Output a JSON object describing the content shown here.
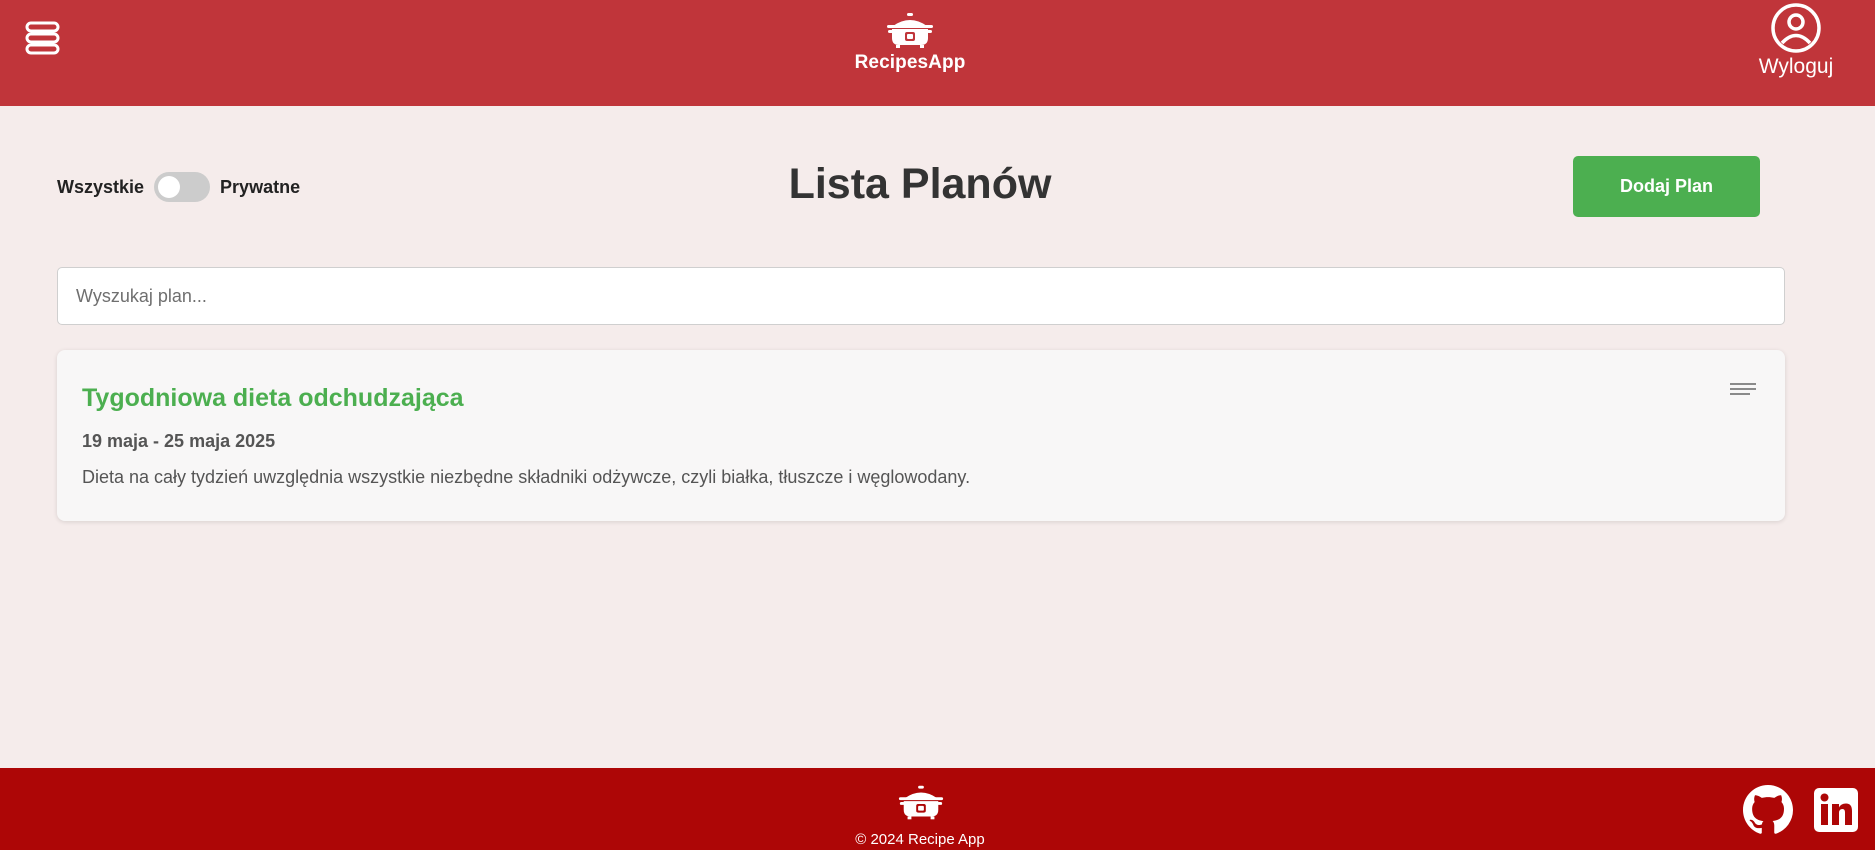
{
  "header": {
    "brand_name": "RecipesApp",
    "logout_label": "Wyloguj"
  },
  "toolbar": {
    "filter_all_label": "Wszystkie",
    "filter_private_label": "Prywatne",
    "private_only": false,
    "page_title": "Lista Planów",
    "add_button_label": "Dodaj Plan"
  },
  "search": {
    "placeholder": "Wyszukaj plan...",
    "value": ""
  },
  "plans": [
    {
      "title": "Tygodniowa dieta odchudzająca",
      "dates": "19 maja - 25 maja 2025",
      "description": "Dieta na cały tydzień uwzględnia wszystkie niezbędne składniki odżywcze, czyli białka, tłuszcze i węglowodany."
    }
  ],
  "footer": {
    "copyright": "© 2024 Recipe App"
  },
  "icons": {
    "menu": "menu-icon",
    "logo": "cooking-pot-icon",
    "user": "user-circle-icon",
    "card_menu": "lines-icon",
    "github": "github-icon",
    "linkedin": "linkedin-icon"
  },
  "colors": {
    "header_bg": "#c0353a",
    "footer_bg": "#ad0606",
    "page_bg": "#f5eceb",
    "accent_green": "#4caf50",
    "card_bg": "#f8f7f7"
  }
}
